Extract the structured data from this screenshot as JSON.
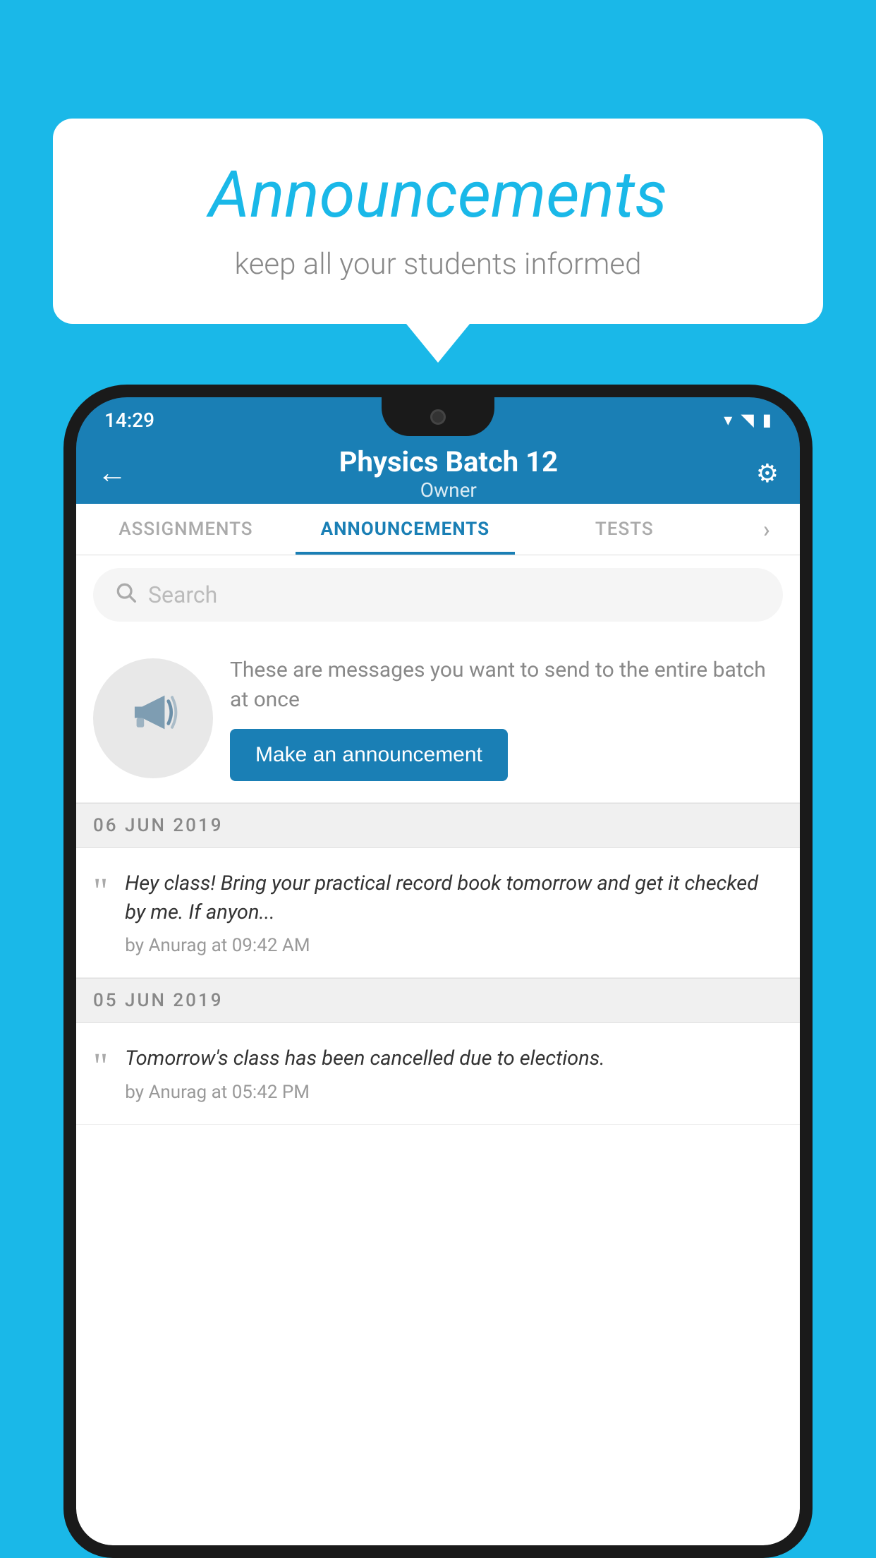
{
  "background_color": "#1ab8e8",
  "speech_bubble": {
    "title": "Announcements",
    "subtitle": "keep all your students informed"
  },
  "phone": {
    "status_bar": {
      "time": "14:29"
    },
    "app_bar": {
      "title": "Physics Batch 12",
      "subtitle": "Owner",
      "back_label": "←",
      "settings_label": "⚙"
    },
    "tabs": [
      {
        "label": "ASSIGNMENTS",
        "active": false
      },
      {
        "label": "ANNOUNCEMENTS",
        "active": true
      },
      {
        "label": "TESTS",
        "active": false
      },
      {
        "label": "›",
        "active": false
      }
    ],
    "search": {
      "placeholder": "Search"
    },
    "promo": {
      "description": "These are messages you want to send to the entire batch at once",
      "button_label": "Make an announcement"
    },
    "announcements": [
      {
        "date": "06  JUN  2019",
        "message": "Hey class! Bring your practical record book tomorrow and get it checked by me. If anyon...",
        "meta": "by Anurag at 09:42 AM"
      },
      {
        "date": "05  JUN  2019",
        "message": "Tomorrow's class has been cancelled due to elections.",
        "meta": "by Anurag at 05:42 PM"
      }
    ]
  }
}
